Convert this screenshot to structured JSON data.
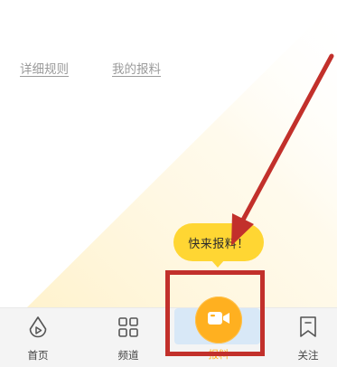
{
  "links": {
    "rules": "详细规则",
    "my_reports": "我的报料"
  },
  "tooltip": {
    "text": "快来报料！"
  },
  "tabbar": {
    "home": {
      "label": "首页",
      "icon": "home-drop-play-icon"
    },
    "channels": {
      "label": "频道",
      "icon": "grid-icon"
    },
    "report": {
      "label": "报料",
      "icon": "video-camera-icon"
    },
    "follow": {
      "label": "关注",
      "icon": "bookmark-icon"
    }
  },
  "colors": {
    "accent": "#ffb020",
    "tooltip": "#ffd633",
    "annotation": "#c2302b",
    "report_tab_bg": "#d8e8f7",
    "link": "#9a9a9a"
  }
}
